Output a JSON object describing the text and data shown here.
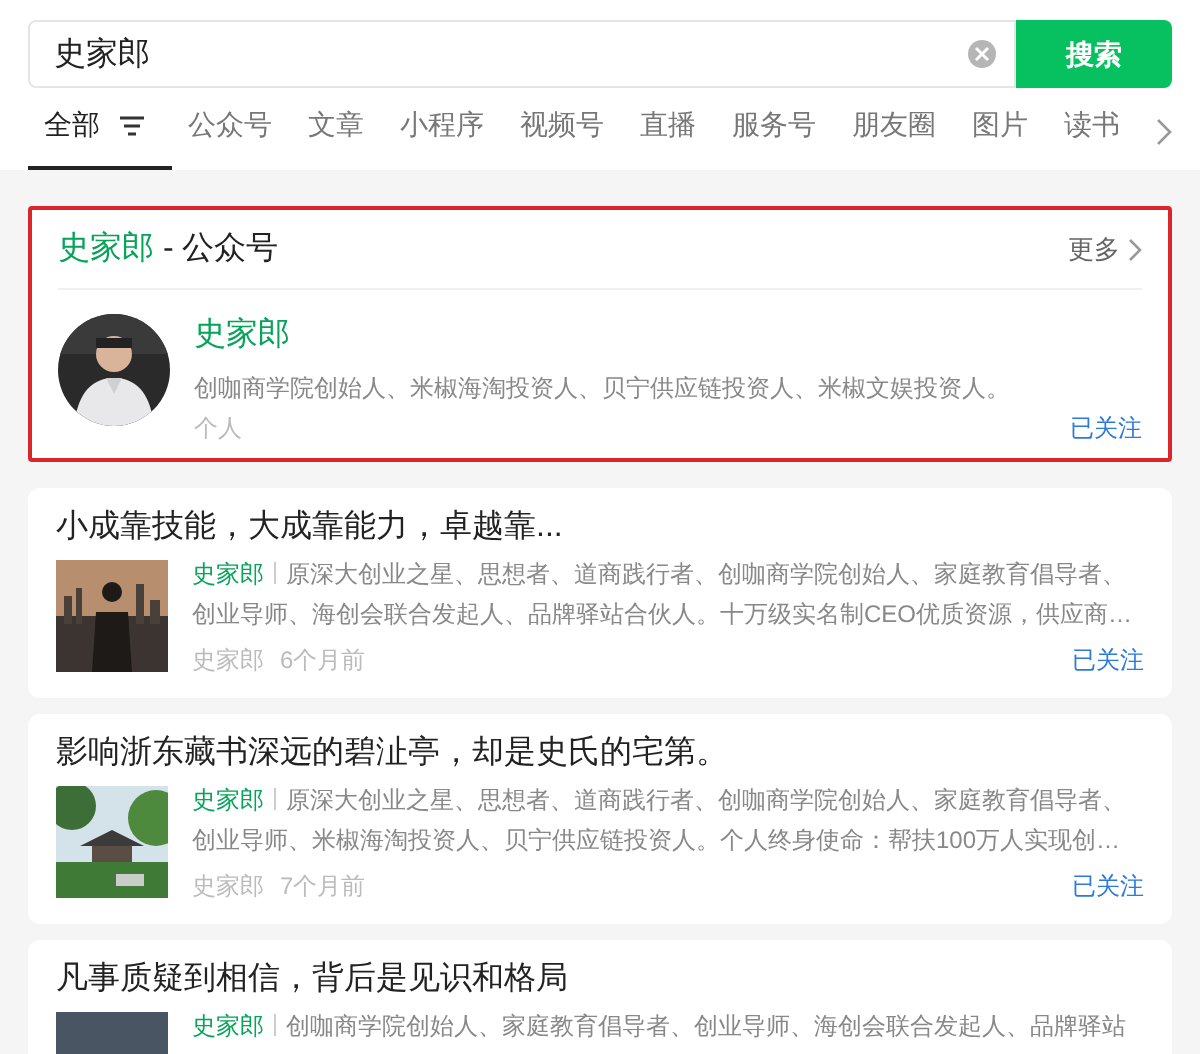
{
  "search": {
    "value": "史家郎",
    "button": "搜索"
  },
  "tabs": [
    {
      "label": "全部",
      "selected": true,
      "filter": true
    },
    {
      "label": "公众号",
      "selected": false
    },
    {
      "label": "文章",
      "selected": false
    },
    {
      "label": "小程序",
      "selected": false
    },
    {
      "label": "视频号",
      "selected": false
    },
    {
      "label": "直播",
      "selected": false
    },
    {
      "label": "服务号",
      "selected": false
    },
    {
      "label": "朋友圈",
      "selected": false
    },
    {
      "label": "图片",
      "selected": false
    },
    {
      "label": "读书",
      "selected": false
    }
  ],
  "account_card": {
    "query": "史家郎",
    "title_suffix": " - 公众号",
    "more": "更多",
    "highlighted": true,
    "account": {
      "name": "史家郎",
      "description": "创咖商学院创始人、米椒海淘投资人、贝宁供应链投资人、米椒文娱投资人。",
      "type": "个人",
      "follow": "已关注"
    }
  },
  "articles": [
    {
      "title": "小成靠技能，大成靠能力，卓越靠...",
      "author": "史家郎",
      "summary": "原深大创业之星、思想者、道商践行者、创咖商学院创始人、家庭教育倡导者、创业导师、海创会联合发起人、品牌驿站合伙人。十万级实名制CEO优质资源，供应商…",
      "source": "史家郎",
      "time": "6个月前",
      "follow": "已关注"
    },
    {
      "title": "影响浙东藏书深远的碧沚亭，却是史氏的宅第。",
      "author": "史家郎",
      "summary": "原深大创业之星、思想者、道商践行者、创咖商学院创始人、家庭教育倡导者、创业导师、米椒海淘投资人、贝宁供应链投资人。个人终身使命：帮扶100万人实现创…",
      "source": "史家郎",
      "time": "7个月前",
      "follow": "已关注"
    },
    {
      "title": "凡事质疑到相信，背后是见识和格局",
      "author": "史家郎",
      "summary": "创咖商学院创始人、家庭教育倡导者、创业导师、海创会联合发起人、品牌驿站"
    }
  ]
}
